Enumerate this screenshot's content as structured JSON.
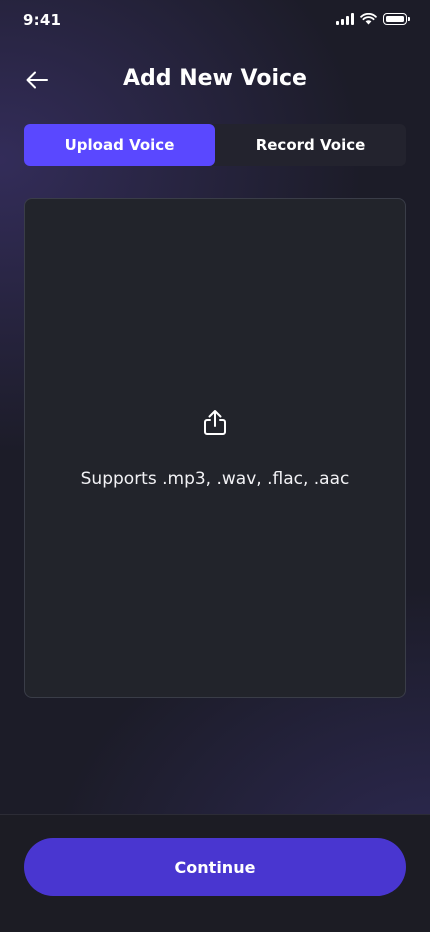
{
  "status_bar": {
    "time": "9:41",
    "icons": [
      "signal-icon",
      "wifi-icon",
      "battery-icon"
    ]
  },
  "header": {
    "back_icon": "arrow-left-icon",
    "title": "Add New Voice"
  },
  "tabs": [
    {
      "label": "Upload Voice",
      "active": true
    },
    {
      "label": "Record Voice",
      "active": false
    }
  ],
  "upload": {
    "icon": "share-upload-icon",
    "hint": "Supports .mp3, .wav, .flac, .aac"
  },
  "footer": {
    "continue_label": "Continue"
  },
  "colors": {
    "accent": "#5a48ff",
    "button": "#4936d0",
    "background": "#1c1c28",
    "panel": "#22242b"
  }
}
